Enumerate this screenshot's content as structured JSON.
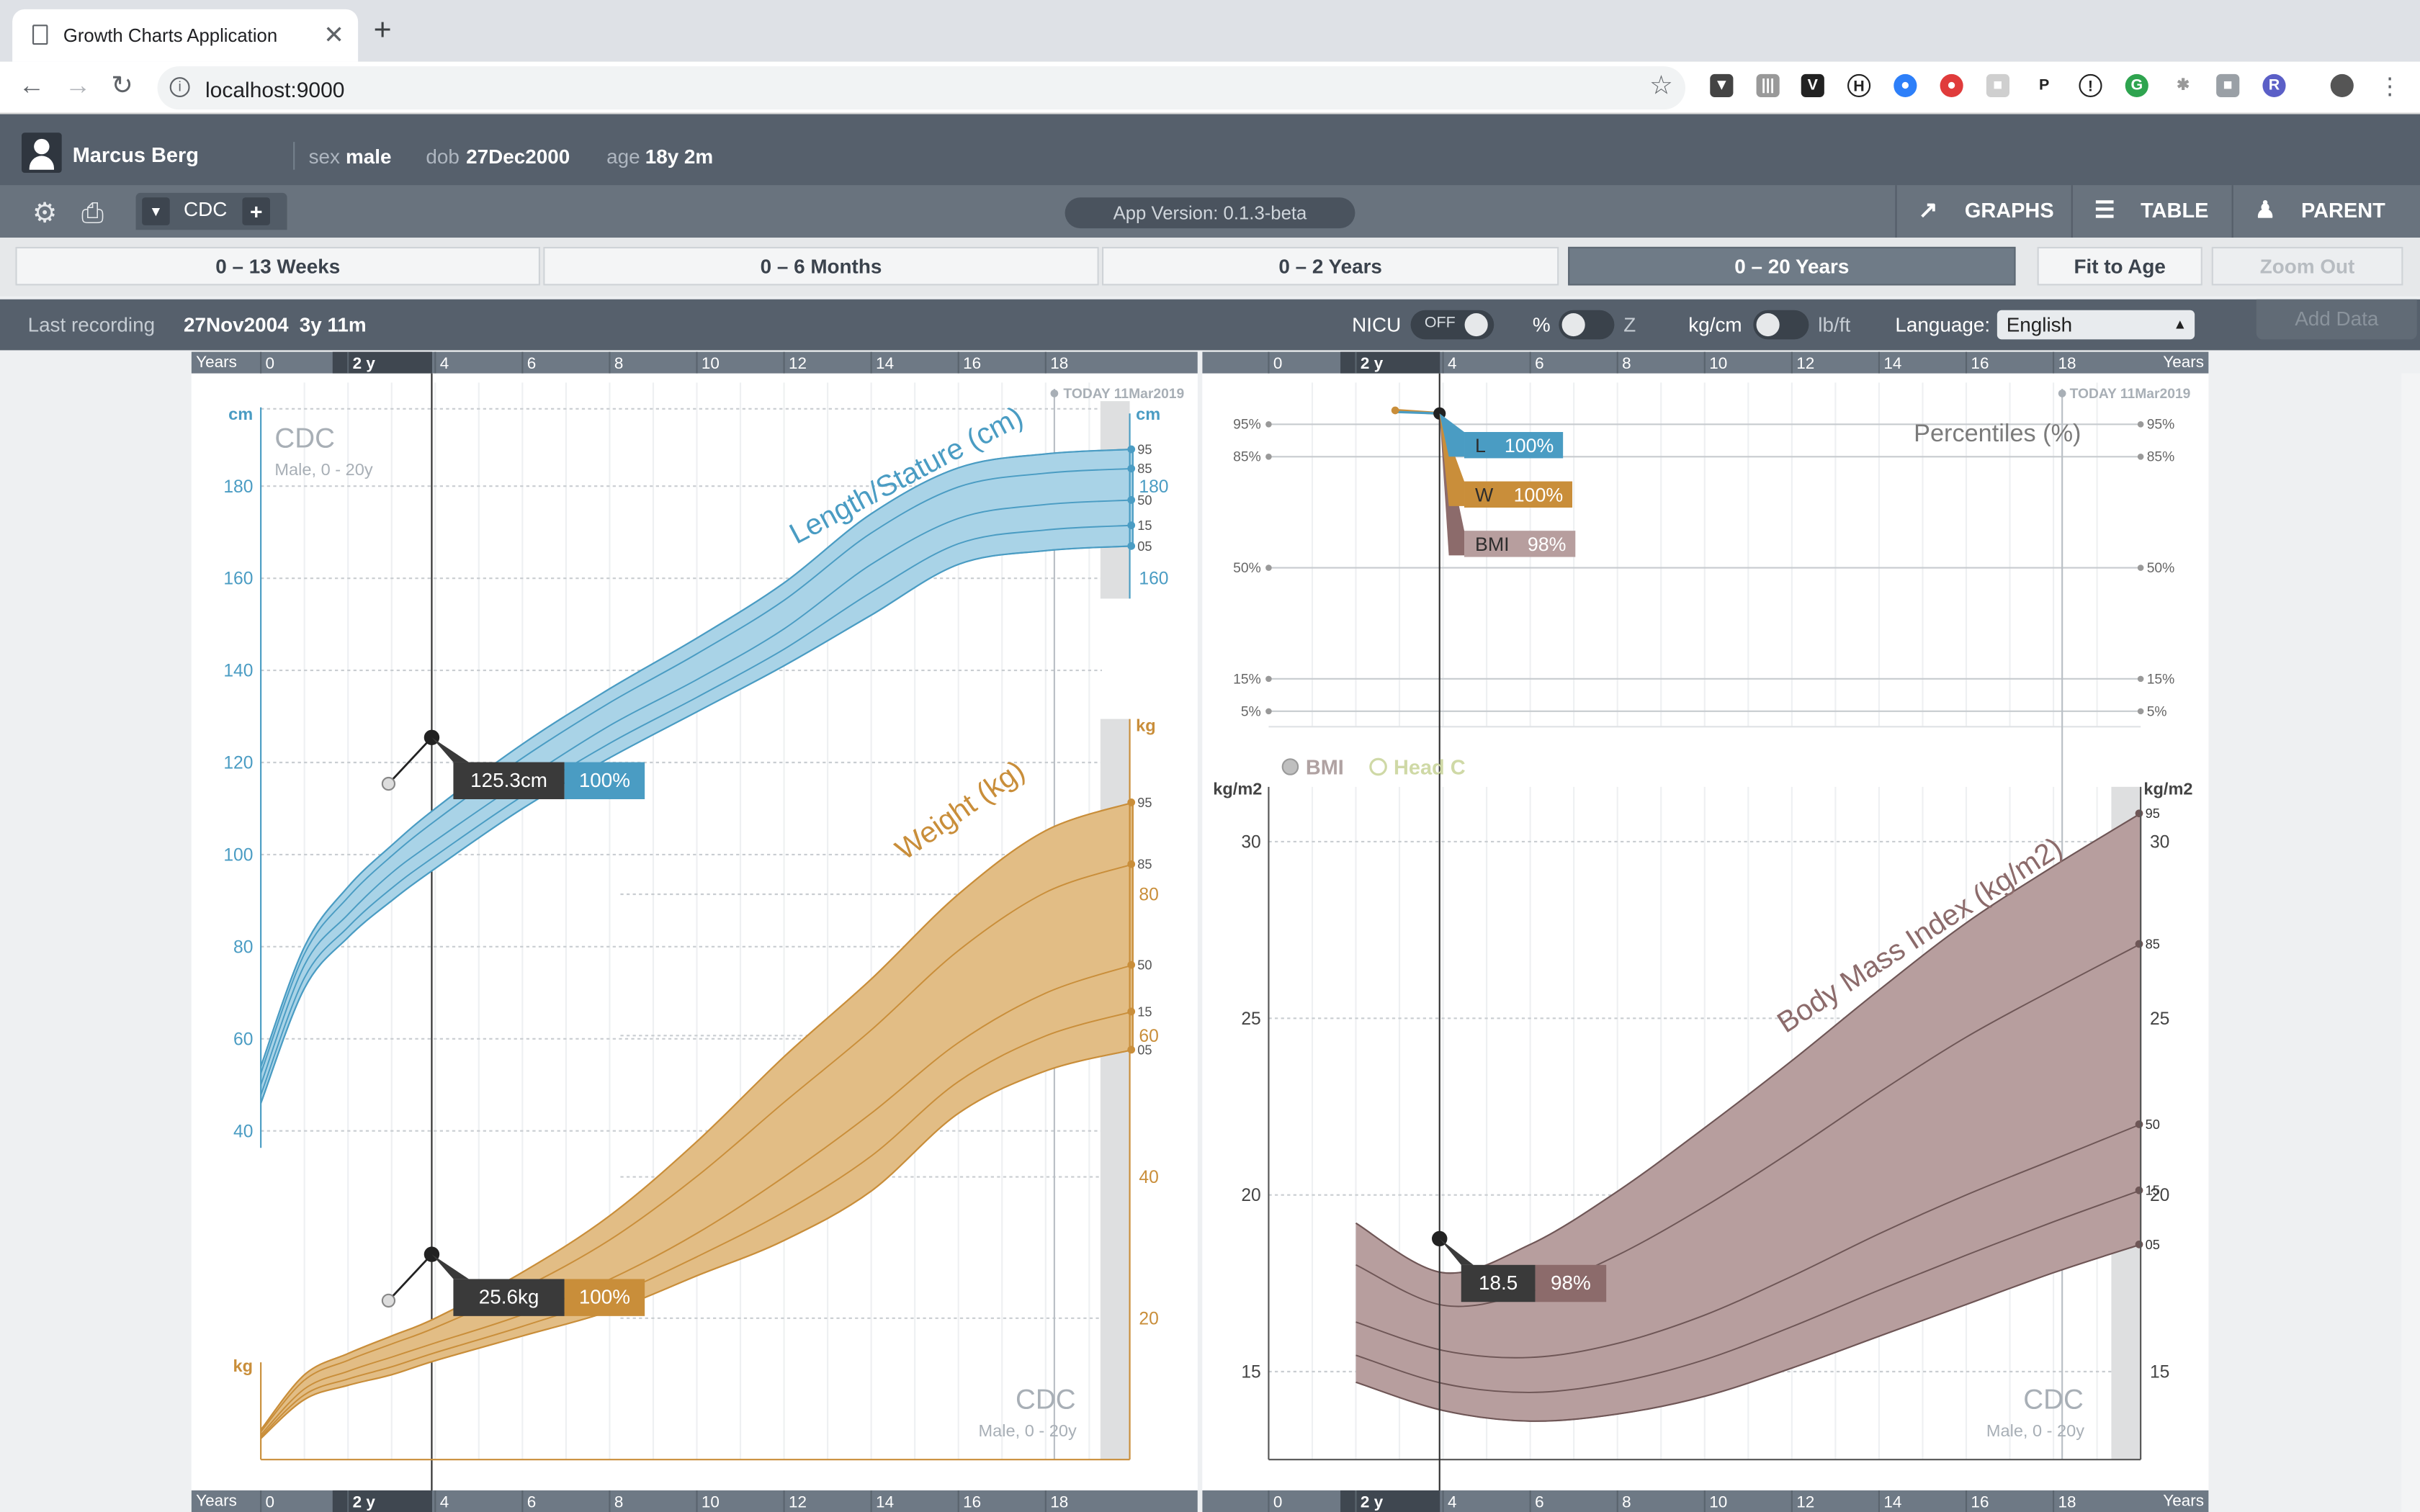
{
  "browser": {
    "tab_title": "Growth Charts Application",
    "url": "localhost:9000",
    "new_tab": "+",
    "close": "✕"
  },
  "patient": {
    "name": "Marcus Berg",
    "sex_label": "sex",
    "sex": "male",
    "dob_label": "dob",
    "dob": "27Dec2000",
    "age_label": "age",
    "age": "18y 2m"
  },
  "toolbar": {
    "dataset": "CDC",
    "version": "App Version: 0.1.3-beta",
    "views": [
      "GRAPHS",
      "TABLE",
      "PARENT"
    ]
  },
  "ranges": {
    "tabs": [
      "0 – 13 Weeks",
      "0 – 6 Months",
      "0 – 2 Years",
      "0 – 20 Years"
    ],
    "active": "0 – 20 Years",
    "fit": "Fit to Age",
    "zoom": "Zoom Out"
  },
  "recording": {
    "label": "Last recording",
    "date": "27Nov2004",
    "age": "3y 11m",
    "nicu_label": "NICU",
    "nicu_state": "OFF",
    "pct_label": "%",
    "z_label": "Z",
    "kgcm_label": "kg/cm",
    "lbft_label": "lb/ft",
    "language_label": "Language:",
    "language": "English",
    "add_data": "Add Data"
  },
  "colors": {
    "length": "#4a9cc3",
    "length_fill": "#a9d3e7",
    "weight": "#c98e3a",
    "weight_fill": "#e2bd85",
    "bmi": "#8c6b6b",
    "bmi_fill": "#b79e9e",
    "dark": "#4a4a4a"
  },
  "axis": {
    "years_label": "Years",
    "ticks": [
      "0",
      "2 y",
      "4",
      "6",
      "8",
      "10",
      "12",
      "14",
      "16",
      "18"
    ]
  },
  "left_chart": {
    "cdc": "CDC",
    "subtitle": "Male, 0 - 20y",
    "today": "TODAY 11Mar2019",
    "length_title": "Length/Stature (cm)",
    "weight_title": "Weight (kg)",
    "cm": "cm",
    "kg": "kg",
    "cm_ticks": [
      "40",
      "60",
      "80",
      "100",
      "120",
      "140",
      "160",
      "180"
    ],
    "cm_ticks_right": [
      "160",
      "180"
    ],
    "kg_ticks_right": [
      "20",
      "40",
      "60",
      "80"
    ],
    "length_percentile_labels": [
      "95",
      "85",
      "50",
      "15",
      "05"
    ],
    "weight_percentile_labels": [
      "95",
      "85",
      "50",
      "15",
      "05"
    ],
    "length_value": "125.3cm",
    "length_pct": "100%",
    "weight_value": "25.6kg",
    "weight_pct": "100%"
  },
  "right_chart": {
    "today": "TODAY 11Mar2019",
    "percentiles_title": "Percentiles (%)",
    "pct_ticks": [
      "95%",
      "85%",
      "50%",
      "15%",
      "5%"
    ],
    "l_label": "L",
    "l_value": "100%",
    "w_label": "W",
    "w_value": "100%",
    "bmi_label": "BMI",
    "bmi_value": "98%",
    "legend_bmi": "BMI",
    "legend_headc": "Head C",
    "unit": "kg/m2",
    "bmi_ticks": [
      "15",
      "20",
      "25",
      "30"
    ],
    "bmi_title": "Body Mass Index (kg/m2)",
    "bmi_percentile_labels": [
      "95",
      "85",
      "50",
      "15",
      "05"
    ],
    "point_value": "18.5",
    "point_pct": "98%",
    "cdc": "CDC",
    "subtitle": "Male, 0 - 20y"
  },
  "chart_data": {
    "type": "line",
    "x_unit": "years",
    "length_cm": {
      "x": [
        0,
        1,
        2,
        3,
        4,
        6,
        8,
        10,
        12,
        14,
        16,
        18,
        20
      ],
      "p05": [
        46,
        71,
        82,
        90,
        97,
        110,
        121,
        131,
        141,
        152,
        163,
        166,
        167
      ],
      "p50": [
        50,
        76,
        87,
        96,
        103,
        116,
        128,
        138,
        149,
        163,
        173,
        176,
        177
      ],
      "p95": [
        54,
        80,
        93,
        102,
        110,
        124,
        136,
        147,
        159,
        174,
        184,
        187,
        188
      ],
      "measurement": {
        "age": 3.92,
        "value": 125.3,
        "percentile": "100%"
      }
    },
    "weight_kg": {
      "x": [
        0,
        1,
        2,
        3,
        4,
        6,
        8,
        10,
        12,
        14,
        16,
        18,
        20
      ],
      "p05": [
        3,
        8.5,
        10.5,
        12,
        14,
        17.5,
        21,
        26,
        31,
        38,
        49,
        55,
        58
      ],
      "p50": [
        3.5,
        10,
        12.5,
        14.5,
        16.5,
        20.5,
        25.5,
        32,
        40,
        49,
        59,
        66,
        70
      ],
      "p95": [
        4.2,
        12,
        15,
        17.5,
        20,
        26.5,
        34.5,
        45,
        57,
        68,
        80,
        89,
        93
      ],
      "measurement": {
        "age": 3.92,
        "value": 25.6,
        "percentile": "100%"
      }
    },
    "bmi": {
      "x": [
        2,
        4,
        6,
        8,
        10,
        12,
        14,
        16,
        18,
        20
      ],
      "p05": [
        14.7,
        13.9,
        13.6,
        13.8,
        14.3,
        15.1,
        16.0,
        16.9,
        17.8,
        18.6
      ],
      "p50": [
        16.4,
        15.6,
        15.4,
        15.8,
        16.6,
        17.7,
        18.9,
        20.0,
        21.0,
        22.0
      ],
      "p95": [
        19.2,
        17.8,
        18.6,
        20.1,
        21.9,
        23.8,
        25.8,
        27.7,
        29.3,
        30.8
      ],
      "measurement": {
        "age": 3.92,
        "value": 18.5,
        "percentile": "98%"
      }
    },
    "percentiles": {
      "length": 100,
      "weight": 100,
      "bmi": 98
    }
  }
}
